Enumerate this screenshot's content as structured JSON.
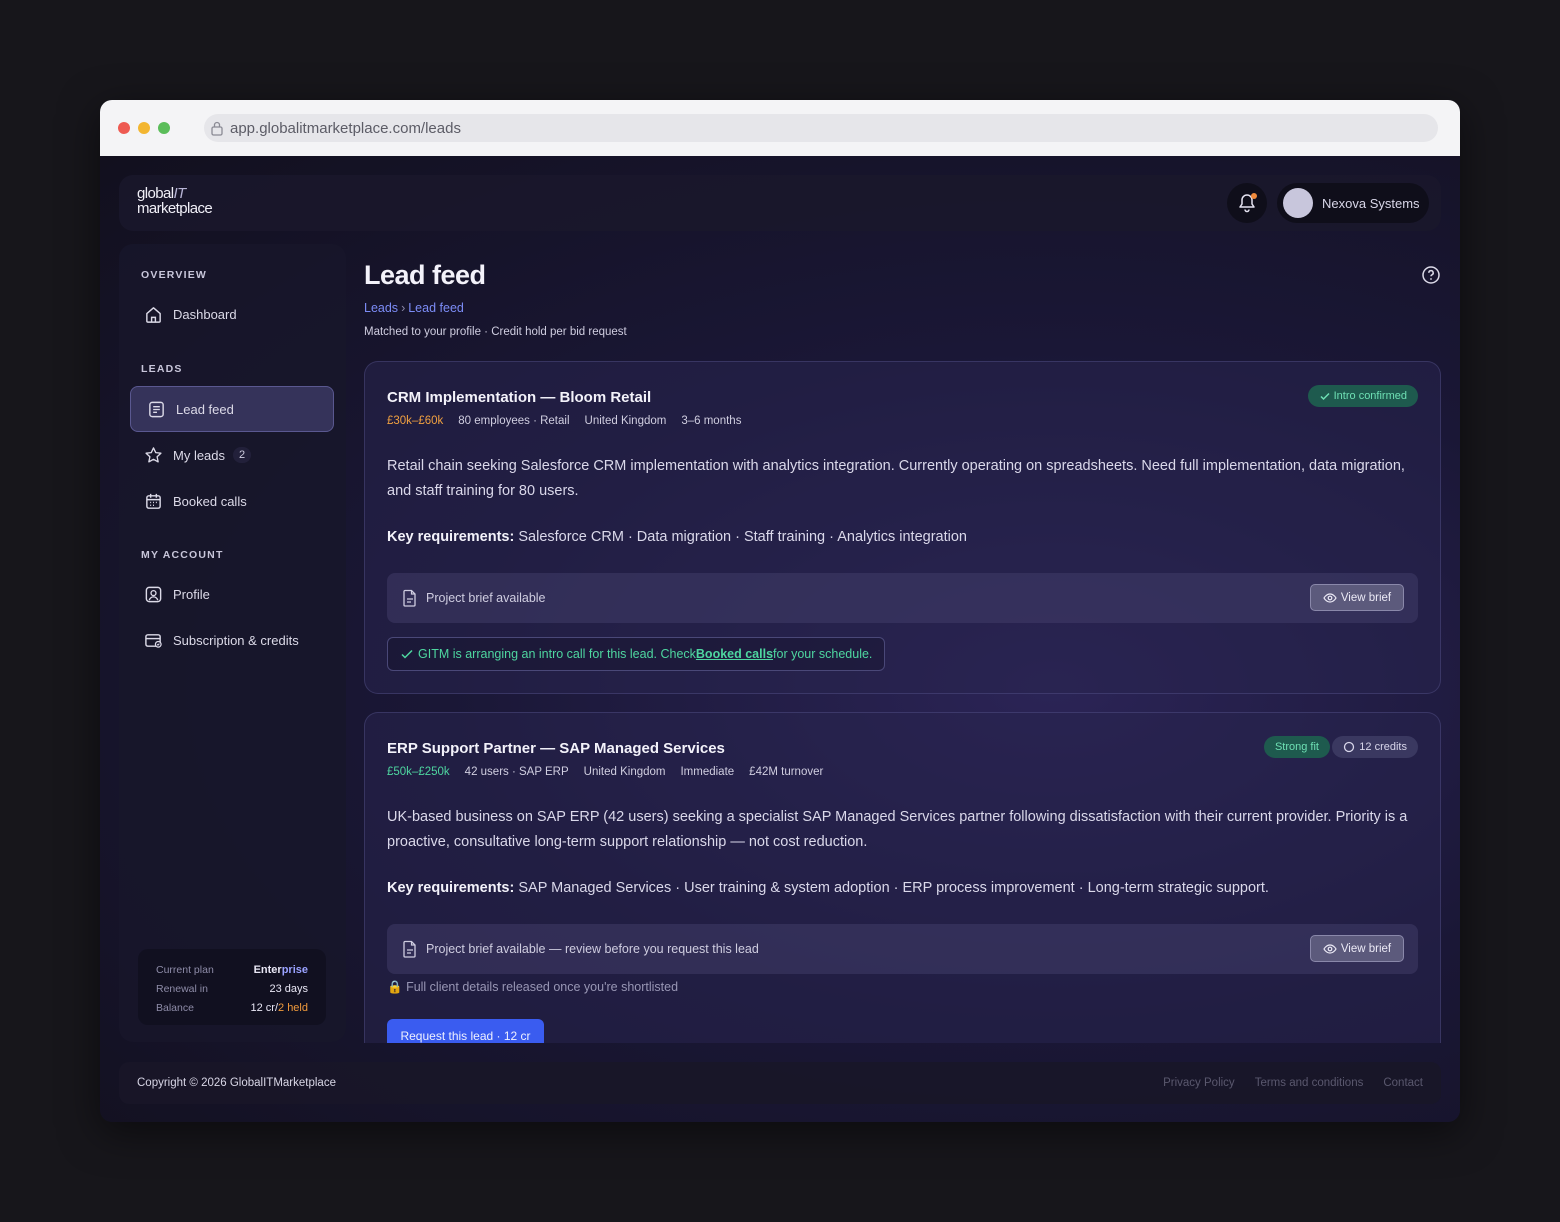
{
  "browser": {
    "url": "app.globalitmarketplace.com/leads"
  },
  "brand": {
    "logo_line1_a": "global",
    "logo_line1_b": "IT",
    "logo_line2": "marketplace"
  },
  "user": {
    "company": "Nexova Systems"
  },
  "sidebar": {
    "sections": [
      {
        "title": "OVERVIEW"
      },
      {
        "title": "LEADS"
      },
      {
        "title": "MY ACCOUNT"
      }
    ],
    "items": [
      {
        "label": "Dashboard",
        "icon": "home-icon"
      },
      {
        "label": "Lead feed",
        "icon": "feed-icon",
        "active": true
      },
      {
        "label": "My leads",
        "icon": "star-icon",
        "count": "2"
      },
      {
        "label": "Booked calls",
        "icon": "calendar-icon"
      },
      {
        "label": "Profile",
        "icon": "user-icon"
      },
      {
        "label": "Subscription & credits",
        "icon": "credit-card-icon"
      }
    ],
    "plan": {
      "plan_label": "Current plan",
      "plan_value_a": "Enter",
      "plan_value_b": "prise",
      "renewal_label": "Renewal in",
      "renewal_value": "23 days",
      "balance_label": "Balance",
      "balance_value": "12 cr/",
      "balance_held": "2 held"
    }
  },
  "page": {
    "title": "Lead feed",
    "breadcrumb": [
      "Leads",
      "Lead feed"
    ],
    "breadcrumb_sep": "›",
    "subtitle": "Matched to your profile · Credit hold per bid request"
  },
  "leads": [
    {
      "title": "CRM Implementation — Bloom Retail",
      "budget": "£30k–£60k",
      "meta": [
        "80 employees · Retail",
        "United Kingdom",
        "3–6 months"
      ],
      "badge": "Intro confirmed",
      "description": "Retail chain seeking Salesforce CRM implementation with analytics integration. Currently operating on spreadsheets. Need full implementation, data migration, and staff training for 80 users.",
      "req_label": "Key requirements:",
      "req_text": " Salesforce CRM · Data migration · Staff training · Analytics integration",
      "brief": "Project brief available",
      "view_brief": "View brief",
      "notice_a": "GITM is arranging an intro call for this lead. Check ",
      "notice_link": "Booked calls",
      "notice_b": " for your schedule."
    },
    {
      "title": "ERP Support Partner — SAP Managed Services",
      "budget": "£50k–£250k",
      "meta": [
        "42 users · SAP ERP",
        "United Kingdom",
        "Immediate",
        "£42M turnover"
      ],
      "badge": "Strong fit",
      "credits": "12 credits",
      "description": "UK-based business on SAP ERP (42 users) seeking a specialist SAP Managed Services partner following dissatisfaction with their current provider. Priority is a proactive, consultative long-term support relationship — not cost reduction.",
      "req_label": "Key requirements:",
      "req_text": " SAP Managed Services · User training & system adoption · ERP process improvement · Long-term strategic support.",
      "brief": "Project brief available — review before you request this lead",
      "view_brief": "View brief",
      "lock_note": "Full client details released once you're shortlisted",
      "request_btn": "Request this lead · 12 cr"
    }
  ],
  "footer": {
    "copyright": "Copyright © 2026 GlobalITMarketplace",
    "links": [
      "Privacy Policy",
      "Terms and conditions",
      "Contact"
    ]
  },
  "colors": {
    "accent": "#3a5cf0",
    "green": "#4ed6a0",
    "orange": "#f0a040"
  }
}
